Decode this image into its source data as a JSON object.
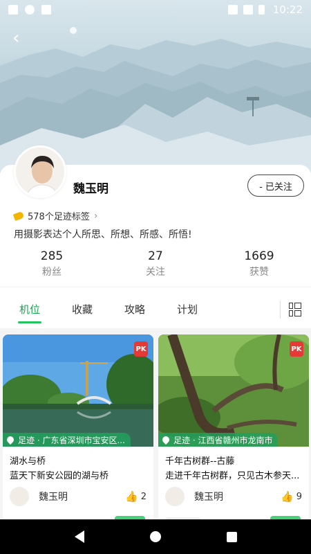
{
  "status_bar": {
    "time": "10:22"
  },
  "profile": {
    "username": "魏玉明",
    "follow_label": "- 已关注",
    "tags_text": "578个足迹标签",
    "bio": "用摄影表达个人所思、所想、所感、所悟!"
  },
  "stats": [
    {
      "value": "285",
      "label": "粉丝"
    },
    {
      "value": "27",
      "label": "关注"
    },
    {
      "value": "1669",
      "label": "获赞"
    }
  ],
  "tabs": [
    {
      "label": "机位",
      "active": true
    },
    {
      "label": "收藏",
      "active": false
    },
    {
      "label": "攻略",
      "active": false
    },
    {
      "label": "计划",
      "active": false
    }
  ],
  "posts": [
    {
      "location": "足迹 · 广东省深圳市宝安区...",
      "title": "湖水与桥",
      "desc": "蓝天下新安公园的湖与桥",
      "author": "魏玉明",
      "likes": "2"
    },
    {
      "location": "足迹 · 江西省赣州市龙南市",
      "title": "千年古树群--古藤",
      "desc": "走进千年古树群，只见古木参天...",
      "author": "魏玉明",
      "likes": "9"
    }
  ],
  "colors": {
    "accent": "#22c55e",
    "chip": "#22a05c",
    "pk": "#e53935"
  }
}
